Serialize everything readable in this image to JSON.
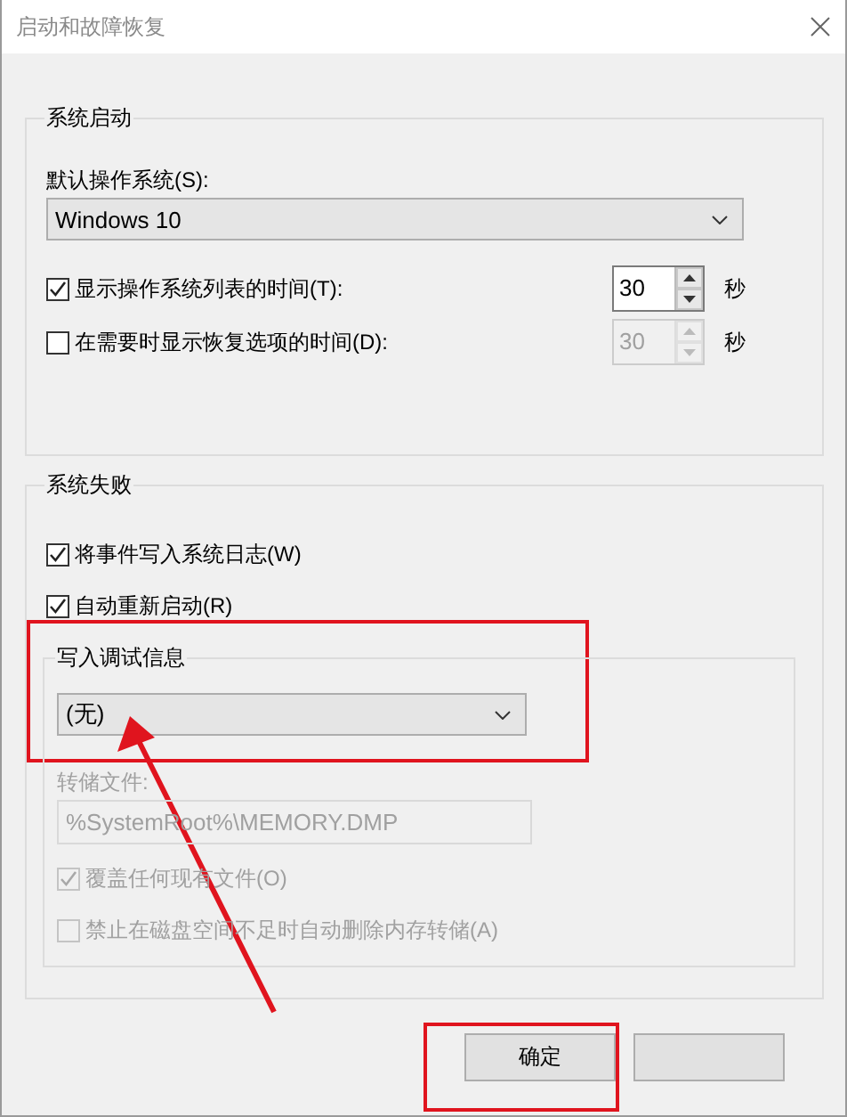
{
  "window": {
    "title": "启动和故障恢复"
  },
  "startup": {
    "title": "系统启动",
    "default_os_label": "默认操作系统(S):",
    "default_os": "Windows 10",
    "timeouts": [
      {
        "label": "显示操作系统列表的时间(T):",
        "checked": true,
        "value": "30",
        "unit": "秒",
        "disabled": false
      },
      {
        "label": "在需要时显示恢复选项的时间(D):",
        "checked": false,
        "value": "30",
        "unit": "秒",
        "disabled": true
      }
    ]
  },
  "failure": {
    "title": "系统失败",
    "options": [
      {
        "label": "将事件写入系统日志(W)",
        "checked": true,
        "disabled": false
      },
      {
        "label": "自动重新启动(R)",
        "checked": true,
        "disabled": false
      }
    ],
    "debug": {
      "title": "写入调试信息",
      "type": "(无)",
      "dump_file_label": "转储文件:",
      "dump_file": "%SystemRoot%\\MEMORY.DMP",
      "disabled": true,
      "options": [
        {
          "label": "覆盖任何现有文件(O)",
          "checked": true,
          "disabled": true
        },
        {
          "label": "禁止在磁盘空间不足时自动删除内存转储(A)",
          "checked": false,
          "disabled": true
        }
      ]
    }
  },
  "buttons": [
    {
      "kind": "text",
      "label": "确定"
    },
    {
      "kind": "blank"
    }
  ],
  "annotations": [
    {
      "kind": "frame"
    },
    {
      "kind": "frame"
    },
    {
      "kind": "arrow"
    }
  ]
}
